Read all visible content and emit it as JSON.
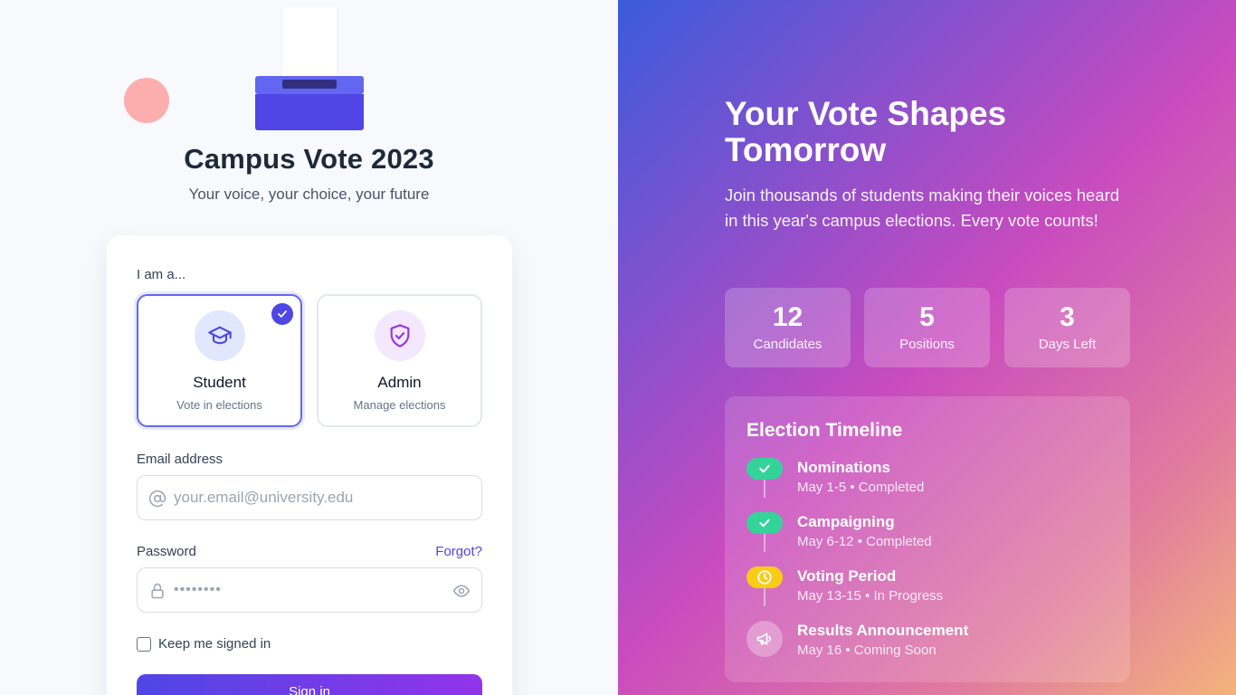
{
  "app": {
    "title": "Campus Vote 2023",
    "subtitle": "Your voice, your choice, your future"
  },
  "login": {
    "role_prompt": "I am a...",
    "roles": [
      {
        "name": "Student",
        "description": "Vote in elections",
        "icon": "graduation-cap-icon",
        "selected": true
      },
      {
        "name": "Admin",
        "description": "Manage elections",
        "icon": "shield-check-icon",
        "selected": false
      }
    ],
    "email_label": "Email address",
    "email_placeholder": "your.email@university.edu",
    "email_value": "",
    "password_label": "Password",
    "password_value": "••••••••",
    "forgot_label": "Forgot?",
    "remember_label": "Keep me signed in",
    "remember_checked": false,
    "signin_label": "Sign in"
  },
  "hero": {
    "title": "Your Vote Shapes Tomorrow",
    "text": "Join thousands of students making their voices heard in this year's campus elections. Every vote counts!"
  },
  "stats": [
    {
      "value": "12",
      "label": "Candidates"
    },
    {
      "value": "5",
      "label": "Positions"
    },
    {
      "value": "3",
      "label": "Days Left"
    }
  ],
  "timeline": {
    "title": "Election Timeline",
    "items": [
      {
        "name": "Nominations",
        "date": "May 1-5 • Completed",
        "status": "completed",
        "icon": "check-icon"
      },
      {
        "name": "Campaigning",
        "date": "May 6-12 • Completed",
        "status": "completed",
        "icon": "check-icon"
      },
      {
        "name": "Voting Period",
        "date": "May 13-15 • In Progress",
        "status": "in-progress",
        "icon": "clock-icon"
      },
      {
        "name": "Results Announcement",
        "date": "May 16 • Coming Soon",
        "status": "upcoming",
        "icon": "megaphone-icon"
      }
    ]
  },
  "colors": {
    "primary": "#4f46e5",
    "accent": "#9333ea",
    "completed": "#34d399",
    "in_progress": "#facc15"
  }
}
